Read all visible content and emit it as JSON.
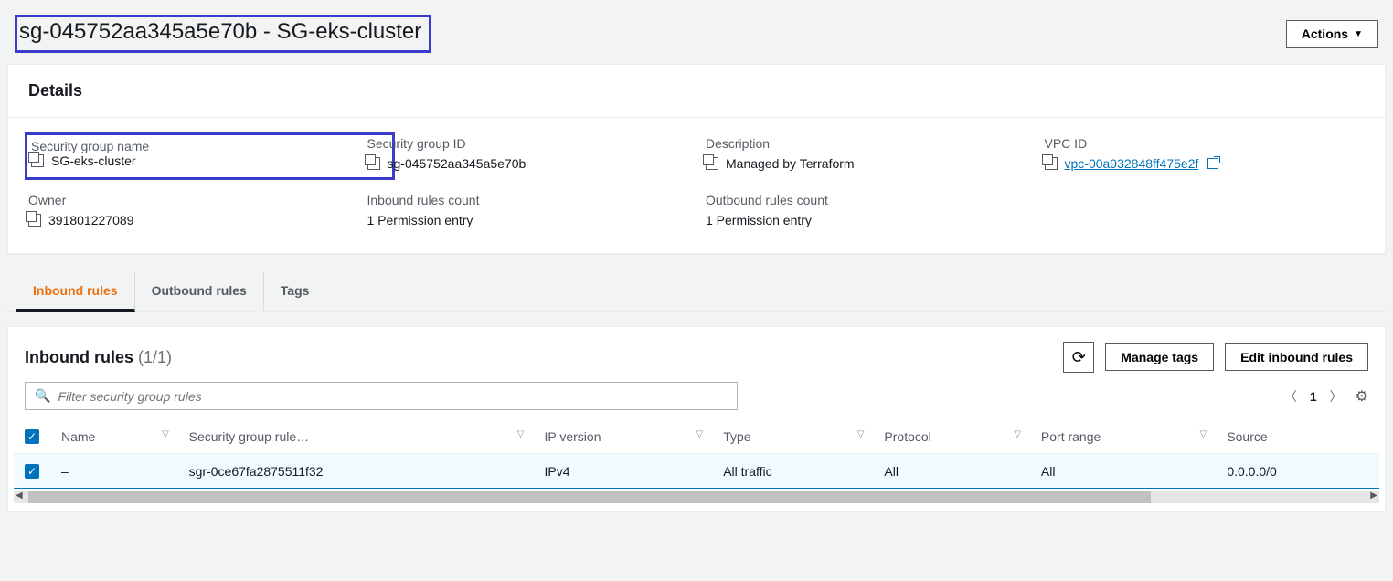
{
  "header": {
    "title": "sg-045752aa345a5e70b - SG-eks-cluster",
    "actions_label": "Actions"
  },
  "details": {
    "section_title": "Details",
    "fields": {
      "sg_name": {
        "label": "Security group name",
        "value": "SG-eks-cluster"
      },
      "sg_id": {
        "label": "Security group ID",
        "value": "sg-045752aa345a5e70b"
      },
      "description": {
        "label": "Description",
        "value": "Managed by Terraform"
      },
      "vpc_id": {
        "label": "VPC ID",
        "value": "vpc-00a932848ff475e2f"
      },
      "owner": {
        "label": "Owner",
        "value": "391801227089"
      },
      "inbound_count": {
        "label": "Inbound rules count",
        "value": "1 Permission entry"
      },
      "outbound_count": {
        "label": "Outbound rules count",
        "value": "1 Permission entry"
      }
    }
  },
  "tabs": {
    "inbound": "Inbound rules",
    "outbound": "Outbound rules",
    "tags": "Tags"
  },
  "rules": {
    "title": "Inbound rules",
    "count": "(1/1)",
    "manage_tags": "Manage tags",
    "edit": "Edit inbound rules",
    "filter_placeholder": "Filter security group rules",
    "page": "1",
    "columns": {
      "name": "Name",
      "rule_id": "Security group rule…",
      "ip_version": "IP version",
      "type": "Type",
      "protocol": "Protocol",
      "port_range": "Port range",
      "source": "Source"
    },
    "rows": [
      {
        "name": "–",
        "rule_id": "sgr-0ce67fa2875511f32",
        "ip_version": "IPv4",
        "type": "All traffic",
        "protocol": "All",
        "port_range": "All",
        "source": "0.0.0.0/0"
      }
    ]
  }
}
